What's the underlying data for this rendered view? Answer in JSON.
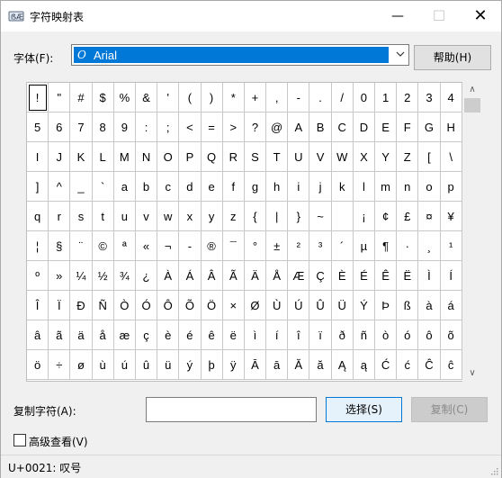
{
  "window": {
    "title": "字符映射表"
  },
  "titlebar": {
    "min": "—",
    "max": "☐",
    "close": "✕"
  },
  "font": {
    "label": "字体(F):",
    "selected": "Arial",
    "icon_glyph": "𝑂"
  },
  "help": {
    "label": "帮助(H)"
  },
  "grid": {
    "rows": [
      [
        "!",
        "\"",
        "#",
        "$",
        "%",
        "&",
        "'",
        "(",
        ")",
        "*",
        "+",
        ",",
        "-",
        ".",
        "/",
        "0",
        "1",
        "2",
        "3",
        "4"
      ],
      [
        "5",
        "6",
        "7",
        "8",
        "9",
        ":",
        ";",
        "<",
        "=",
        ">",
        "?",
        "@",
        "A",
        "B",
        "C",
        "D",
        "E",
        "F",
        "G",
        "H"
      ],
      [
        "I",
        "J",
        "K",
        "L",
        "M",
        "N",
        "O",
        "P",
        "Q",
        "R",
        "S",
        "T",
        "U",
        "V",
        "W",
        "X",
        "Y",
        "Z",
        "[",
        "\\"
      ],
      [
        "]",
        "^",
        "_",
        "`",
        "a",
        "b",
        "c",
        "d",
        "e",
        "f",
        "g",
        "h",
        "i",
        "j",
        "k",
        "l",
        "m",
        "n",
        "o",
        "p"
      ],
      [
        "q",
        "r",
        "s",
        "t",
        "u",
        "v",
        "w",
        "x",
        "y",
        "z",
        "{",
        "|",
        "}",
        "~",
        " ",
        "¡",
        "¢",
        "£",
        "¤",
        "¥"
      ],
      [
        "¦",
        "§",
        "¨",
        "©",
        "ª",
        "«",
        "¬",
        "-",
        "®",
        "¯",
        "°",
        "±",
        "²",
        "³",
        "´",
        "µ",
        "¶",
        "·",
        "¸",
        "¹"
      ],
      [
        "º",
        "»",
        "¼",
        "½",
        "¾",
        "¿",
        "À",
        "Á",
        "Â",
        "Ã",
        "Ä",
        "Å",
        "Æ",
        "Ç",
        "È",
        "É",
        "Ê",
        "Ë",
        "Ì",
        "Í"
      ],
      [
        "Î",
        "Ï",
        "Ð",
        "Ñ",
        "Ò",
        "Ó",
        "Ô",
        "Õ",
        "Ö",
        "×",
        "Ø",
        "Ù",
        "Ú",
        "Û",
        "Ü",
        "Ý",
        "Þ",
        "ß",
        "à",
        "á"
      ],
      [
        "â",
        "ã",
        "ä",
        "å",
        "æ",
        "ç",
        "è",
        "é",
        "ê",
        "ë",
        "ì",
        "í",
        "î",
        "ï",
        "ð",
        "ñ",
        "ò",
        "ó",
        "ô",
        "õ"
      ],
      [
        "ö",
        "÷",
        "ø",
        "ù",
        "ú",
        "û",
        "ü",
        "ý",
        "þ",
        "ÿ",
        "Ā",
        "ā",
        "Ă",
        "ă",
        "Ą",
        "ą",
        "Ć",
        "ć",
        "Ĉ",
        "ĉ"
      ]
    ],
    "selected_row": 0,
    "selected_col": 0
  },
  "scroll": {
    "up": "∧",
    "down": "∨"
  },
  "copy": {
    "label": "复制字符(A):",
    "value": "",
    "select_label": "选择(S)",
    "copy_label": "复制(C)"
  },
  "advanced": {
    "label": "高级查看(V)"
  },
  "status": {
    "text": "U+0021: 叹号"
  }
}
